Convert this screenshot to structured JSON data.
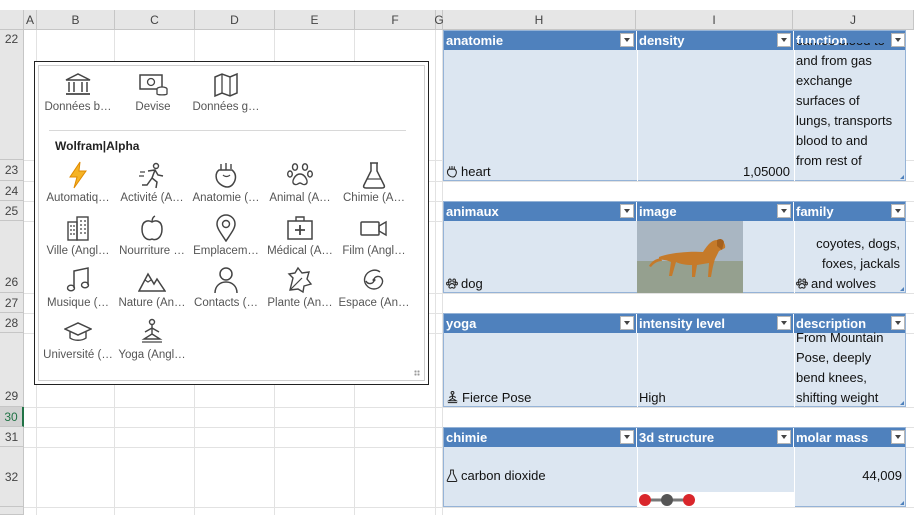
{
  "columns": [
    "A",
    "B",
    "C",
    "D",
    "E",
    "F",
    "G",
    "H",
    "I",
    "J"
  ],
  "rows": [
    "22",
    "23",
    "24",
    "25",
    "26",
    "27",
    "28",
    "29",
    "30",
    "31",
    "32"
  ],
  "panel": {
    "top_items": [
      {
        "label": "Données b…",
        "icon": "bank-icon"
      },
      {
        "label": "Devise",
        "icon": "currency-icon"
      },
      {
        "label": "Données g…",
        "icon": "map-icon"
      }
    ],
    "section_title": "Wolfram|Alpha",
    "items": [
      {
        "label": "Automatiq…",
        "icon": "lightning-icon"
      },
      {
        "label": "Activité (A…",
        "icon": "running-icon"
      },
      {
        "label": "Anatomie (…",
        "icon": "heart-anatomy-icon"
      },
      {
        "label": "Animal (A…",
        "icon": "paw-icon"
      },
      {
        "label": "Chimie (A…",
        "icon": "flask-icon"
      },
      {
        "label": "Ville (Angl…",
        "icon": "city-icon"
      },
      {
        "label": "Nourriture …",
        "icon": "apple-icon"
      },
      {
        "label": "Emplacem…",
        "icon": "location-pin-icon"
      },
      {
        "label": "Médical (A…",
        "icon": "medical-kit-icon"
      },
      {
        "label": "Film (Angl…",
        "icon": "film-camera-icon"
      },
      {
        "label": "Musique (…",
        "icon": "music-note-icon"
      },
      {
        "label": "Nature (An…",
        "icon": "mountain-icon"
      },
      {
        "label": "Contacts (…",
        "icon": "person-icon"
      },
      {
        "label": "Plante (An…",
        "icon": "leaf-icon"
      },
      {
        "label": "Espace (An…",
        "icon": "galaxy-icon"
      },
      {
        "label": "Université (…",
        "icon": "graduation-cap-icon"
      },
      {
        "label": "Yoga (Angl…",
        "icon": "yoga-icon"
      }
    ]
  },
  "tables": [
    {
      "headers": [
        "anatomie",
        "density",
        "function"
      ],
      "entity": "heart",
      "entity_icon": "heart-anatomy-icon",
      "value2": "1,05000",
      "value3_lines": [
        "carries blood to",
        "and from gas",
        "exchange",
        "surfaces of",
        "lungs, transports",
        "blood to and",
        "from rest of"
      ]
    },
    {
      "headers": [
        "animaux",
        "image",
        "family"
      ],
      "entity": "dog",
      "entity_icon": "paw-icon",
      "value2": "",
      "value3_lines": [
        "coyotes, dogs,",
        "foxes, jackals",
        "and wolves"
      ]
    },
    {
      "headers": [
        "yoga",
        "intensity level",
        "description"
      ],
      "entity": "Fierce Pose",
      "entity_icon": "yoga-icon",
      "value2": "High",
      "value3_lines": [
        "From Mountain",
        "Pose, deeply",
        "bend knees,",
        "shifting weight"
      ]
    },
    {
      "headers": [
        "chimie",
        "3d structure",
        "molar mass"
      ],
      "entity": "carbon dioxide",
      "entity_icon": "flask-icon",
      "value2": "",
      "value3_lines": [
        "44,009"
      ]
    }
  ],
  "colors": {
    "table_header": "#4f81bd",
    "table_body": "#dce6f1",
    "selected_row": "#217346"
  }
}
